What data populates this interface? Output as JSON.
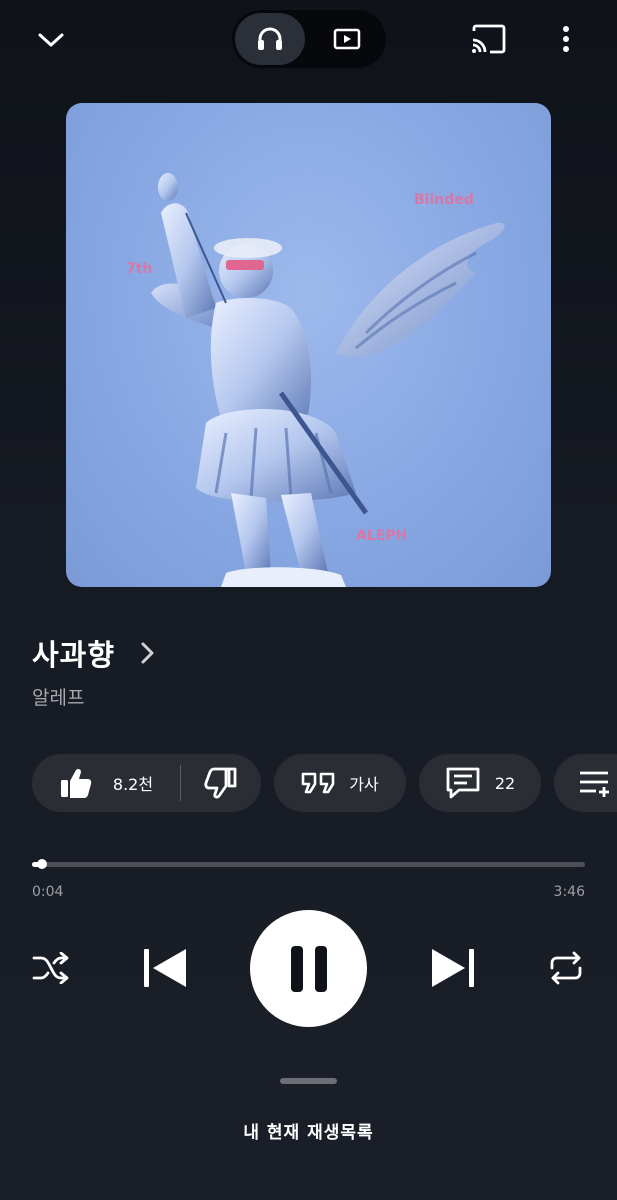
{
  "top_bar": {
    "down_icon": "chevron-down-icon",
    "mode_toggle": {
      "audio_icon": "headphones-icon",
      "video_icon": "video-play-icon",
      "selected": "audio"
    },
    "cast_icon": "cast-icon",
    "more_icon": "more-vert-icon"
  },
  "album_art": {
    "label_top_right": "Blinded",
    "label_left": "7th",
    "label_bottom": "ALEPH"
  },
  "song": {
    "title": "사과향",
    "artist": "알레프"
  },
  "actions": {
    "like_count": "8.2천",
    "lyrics_label": "가사",
    "comments_count": "22",
    "icons": [
      "thumb-up-icon",
      "thumb-down-icon",
      "lyrics-quote-icon",
      "comment-icon",
      "add-to-playlist-icon"
    ]
  },
  "progress": {
    "current_time": "0:04",
    "total_time": "3:46",
    "fraction": 0.018
  },
  "controls": {
    "icons": [
      "shuffle-icon",
      "previous-icon",
      "pause-icon",
      "next-icon",
      "repeat-icon"
    ],
    "state": "playing"
  },
  "queue": {
    "label": "내 현재 재생목록"
  },
  "colors": {
    "background": "#161a22",
    "chip": "#2a2d34",
    "art_accent": "#d977a8",
    "art_sky": "#86a6e2"
  }
}
